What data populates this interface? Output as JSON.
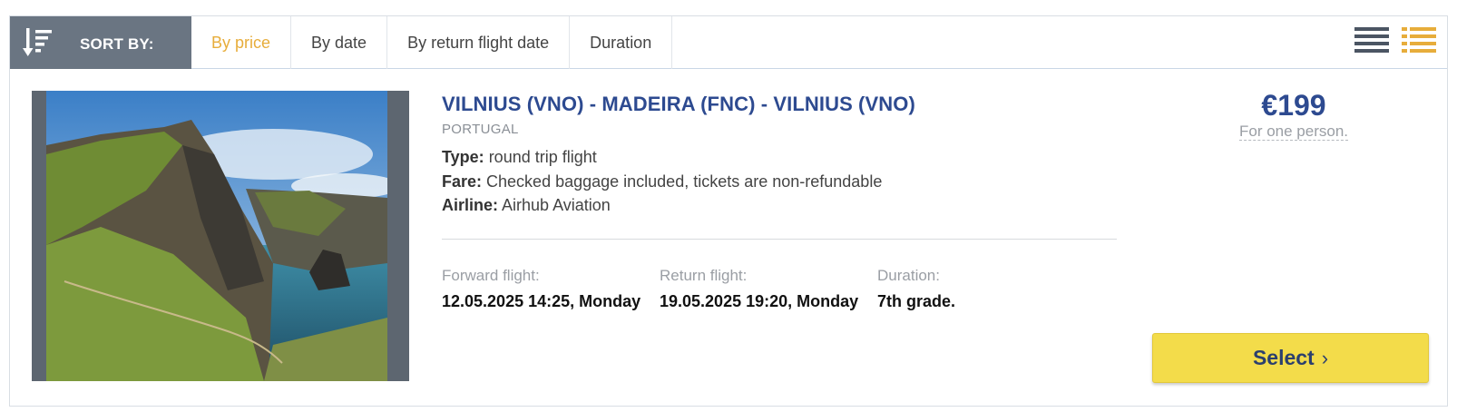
{
  "sort_bar": {
    "label": "SORT BY:",
    "icon": "sort-descending-icon",
    "tabs": [
      {
        "label": "By price",
        "active": true
      },
      {
        "label": "By date",
        "active": false
      },
      {
        "label": "By return flight date",
        "active": false
      },
      {
        "label": "Duration",
        "active": false
      }
    ],
    "view_modes": [
      {
        "icon": "list-view-icon",
        "active": false
      },
      {
        "icon": "detailed-list-view-icon",
        "active": true
      }
    ]
  },
  "offer": {
    "image": "madeira-coastline-photo",
    "route": "VILNIUS (VNO) - MADEIRA (FNC) - VILNIUS (VNO)",
    "country": "PORTUGAL",
    "type_label": "Type:",
    "type_value": "round trip flight",
    "fare_label": "Fare:",
    "fare_value": "Checked baggage included, tickets are non-refundable",
    "airline_label": "Airline:",
    "airline_value": "Airhub Aviation",
    "forward_label": "Forward flight:",
    "forward_value": "12.05.2025 14:25, Monday",
    "return_label": "Return flight:",
    "return_value": "19.05.2025 19:20, Monday",
    "duration_label": "Duration:",
    "duration_value": "7th grade.",
    "price": "€199",
    "price_note": "For one person.",
    "select_label": "Select"
  },
  "colors": {
    "accent": "#e7ad3b",
    "title_blue": "#2d4a90",
    "sort_bg": "#6a7582",
    "button_yellow": "#f3dc4a"
  }
}
